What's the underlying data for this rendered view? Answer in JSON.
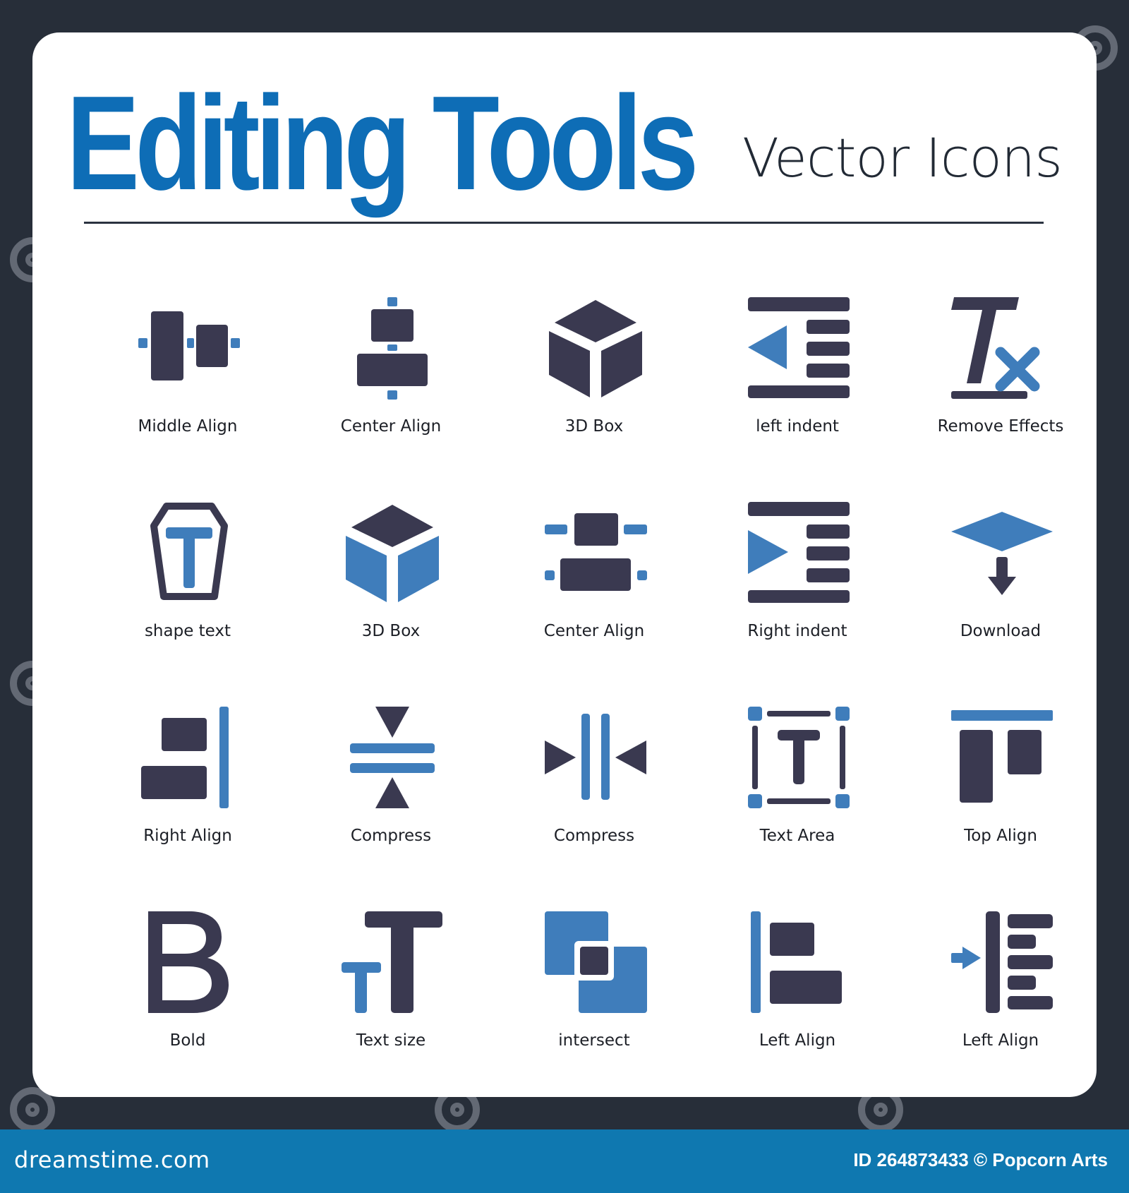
{
  "title": {
    "main": "Editing Tools",
    "sub": "Vector Icons"
  },
  "colors": {
    "dark": "#3a3950",
    "blue": "#3f7dbb",
    "title_blue": "#0e6db6",
    "frame": "#272e39",
    "footer": "#0f78b0"
  },
  "icons": [
    {
      "label": "Middle Align",
      "icon": "middle-align-icon"
    },
    {
      "label": "Center Align",
      "icon": "center-align-vertical-icon"
    },
    {
      "label": "3D Box",
      "icon": "3d-box-solid-icon"
    },
    {
      "label": "left indent",
      "icon": "left-indent-icon"
    },
    {
      "label": "Remove Effects",
      "icon": "remove-formatting-icon"
    },
    {
      "label": "shape text",
      "icon": "shape-text-icon"
    },
    {
      "label": "3D Box",
      "icon": "3d-box-two-tone-icon"
    },
    {
      "label": "Center Align",
      "icon": "center-align-horizontal-icon"
    },
    {
      "label": "Right indent",
      "icon": "right-indent-icon"
    },
    {
      "label": "Download",
      "icon": "download-layer-icon"
    },
    {
      "label": "Right Align",
      "icon": "right-align-icon"
    },
    {
      "label": "Compress",
      "icon": "compress-vertical-icon"
    },
    {
      "label": "Compress",
      "icon": "compress-horizontal-icon"
    },
    {
      "label": "Text Area",
      "icon": "text-area-icon"
    },
    {
      "label": "Top Align",
      "icon": "top-align-icon"
    },
    {
      "label": "Bold",
      "icon": "bold-icon"
    },
    {
      "label": "Text size",
      "icon": "text-size-icon"
    },
    {
      "label": "intersect",
      "icon": "intersect-icon"
    },
    {
      "label": "Left Align",
      "icon": "left-align-icon"
    },
    {
      "label": "Left Align",
      "icon": "left-align-arrow-icon"
    }
  ],
  "footer": {
    "brand": "dreamstime.com",
    "credit": "ID 264873433 © Popcorn Arts"
  }
}
